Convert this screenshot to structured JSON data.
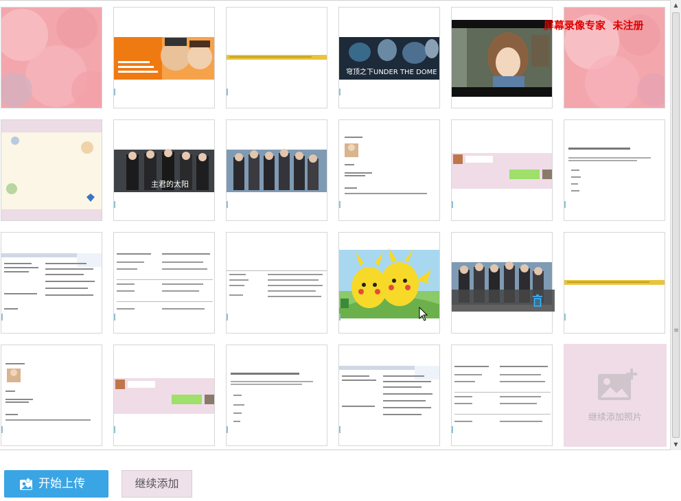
{
  "watermark": "屏幕录像专家  未注册",
  "thumbnails": {
    "count": 23,
    "row1": [
      "pink-abstract",
      "family-banner",
      "yellow-strip",
      "under-the-dome",
      "anime-girl",
      "pink-abstract"
    ],
    "row2": [
      "pastel-frame",
      "drama-poster-1",
      "group-poster",
      "document-page",
      "chat-screenshot",
      "chinese-text-page"
    ],
    "row3": [
      "document-page",
      "table-page",
      "table-page",
      "pikachu",
      "group-poster",
      "yellow-strip"
    ],
    "row4": [
      "document-page",
      "chat-screenshot",
      "chinese-text-page",
      "document-page",
      "table-page"
    ]
  },
  "captions": {
    "dome": "穹顶之下UNDER THE DOME",
    "drama": "主君的太阳"
  },
  "add_more_tile": {
    "label": "继续添加照片",
    "icon": "image-add-icon"
  },
  "buttons": {
    "upload": "开始上传",
    "continue": "继续添加"
  },
  "colors": {
    "accent": "#3aa5e4",
    "pink_tile": "#efdce7",
    "watermark": "#e00000"
  }
}
